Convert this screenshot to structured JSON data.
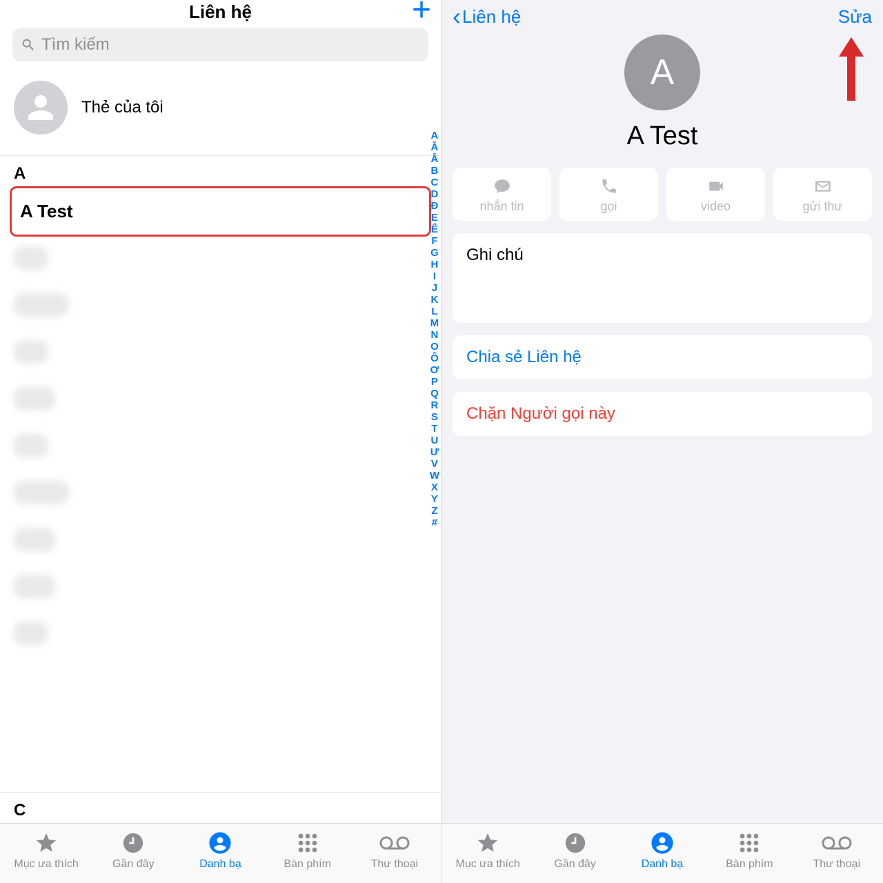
{
  "left": {
    "title": "Liên hệ",
    "search_placeholder": "Tìm kiếm",
    "my_card": "Thẻ của tôi",
    "section_a": "A",
    "contact_name": "A Test",
    "section_c": "C",
    "index": [
      "A",
      "Ă",
      "Â",
      "B",
      "C",
      "D",
      "Đ",
      "E",
      "Ê",
      "F",
      "G",
      "H",
      "I",
      "J",
      "K",
      "L",
      "M",
      "N",
      "O",
      "Ô",
      "Ơ",
      "P",
      "Q",
      "R",
      "S",
      "T",
      "U",
      "Ư",
      "V",
      "W",
      "X",
      "Y",
      "Z",
      "#"
    ]
  },
  "right": {
    "back": "Liên hệ",
    "edit": "Sửa",
    "avatar_letter": "A",
    "name": "A Test",
    "actions": {
      "message": "nhắn tin",
      "call": "gọi",
      "video": "video",
      "mail": "gửi thư"
    },
    "notes": "Ghi chú",
    "share": "Chia sẻ Liên hệ",
    "block": "Chặn Người gọi này"
  },
  "tabs": {
    "fav": "Mục ưa thích",
    "recent": "Gần đây",
    "contacts": "Danh bạ",
    "keypad": "Bàn phím",
    "voicemail": "Thư thoại"
  }
}
